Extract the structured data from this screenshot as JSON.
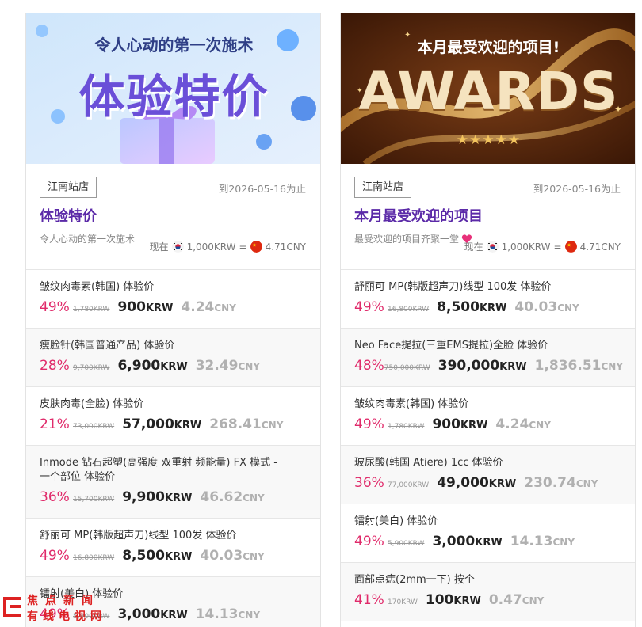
{
  "cards": [
    {
      "banner": {
        "headline": "令人心动的第一次施术",
        "big_text": "体验特价"
      },
      "store": "江南站店",
      "deadline": "到2026-05-16为止",
      "title": "体验特价",
      "subtitle": "令人心动的第一次施术",
      "rate": {
        "prefix": "现在",
        "krw": "1,000KRW",
        "eq": "=",
        "cny": "4.71CNY"
      },
      "items": [
        {
          "name": "皱纹肉毒素(韩国) 体验价",
          "discount": "49%",
          "original": "1,780KRW",
          "price": "900",
          "price_unit": "KRW",
          "cny": "4.24",
          "cny_unit": "CNY"
        },
        {
          "name": "瘦脸针(韩国普通产品) 体验价",
          "discount": "28%",
          "original": "9,700KRW",
          "price": "6,900",
          "price_unit": "KRW",
          "cny": "32.49",
          "cny_unit": "CNY"
        },
        {
          "name": "皮肤肉毒(全脸) 体验价",
          "discount": "21%",
          "original": "73,000KRW",
          "price": "57,000",
          "price_unit": "KRW",
          "cny": "268.41",
          "cny_unit": "CNY"
        },
        {
          "name": "Inmode 钻石超塑(高强度 双重射 频能量) FX 模式 - 一个部位 体验价",
          "discount": "36%",
          "original": "15,700KRW",
          "price": "9,900",
          "price_unit": "KRW",
          "cny": "46.62",
          "cny_unit": "CNY"
        },
        {
          "name": "舒丽可 MP(韩版超声刀)线型 100发 体验价",
          "discount": "49%",
          "original": "16,800KRW",
          "price": "8,500",
          "price_unit": "KRW",
          "cny": "40.03",
          "cny_unit": "CNY"
        },
        {
          "name": "镭射(美白) 体验价",
          "discount": "49%",
          "original": "5,900KRW",
          "price": "3,000",
          "price_unit": "KRW",
          "cny": "14.13",
          "cny_unit": "CNY"
        }
      ]
    },
    {
      "banner": {
        "headline": "本月最受欢迎的项目!",
        "big_text": "AWARDS",
        "stars": "★★★★★"
      },
      "store": "江南站店",
      "deadline": "到2026-05-16为止",
      "title": "本月最受欢迎的项目",
      "subtitle": "最受欢迎的项目齐聚一堂",
      "rate": {
        "prefix": "现在",
        "krw": "1,000KRW",
        "eq": "=",
        "cny": "4.71CNY"
      },
      "items": [
        {
          "name": "舒丽可 MP(韩版超声刀)线型 100发 体验价",
          "discount": "49%",
          "original": "16,800KRW",
          "price": "8,500",
          "price_unit": "KRW",
          "cny": "40.03",
          "cny_unit": "CNY"
        },
        {
          "name": "Neo Face提拉(三重EMS提拉)全脸 体验价",
          "discount": "48%",
          "original": "750,000KRW",
          "price": "390,000",
          "price_unit": "KRW",
          "cny": "1,836.51",
          "cny_unit": "CNY"
        },
        {
          "name": "皱纹肉毒素(韩国) 体验价",
          "discount": "49%",
          "original": "1,780KRW",
          "price": "900",
          "price_unit": "KRW",
          "cny": "4.24",
          "cny_unit": "CNY"
        },
        {
          "name": "玻尿酸(韩国 Atiere) 1cc 体验价",
          "discount": "36%",
          "original": "77,000KRW",
          "price": "49,000",
          "price_unit": "KRW",
          "cny": "230.74",
          "cny_unit": "CNY"
        },
        {
          "name": "镭射(美白) 体验价",
          "discount": "49%",
          "original": "5,900KRW",
          "price": "3,000",
          "price_unit": "KRW",
          "cny": "14.13",
          "cny_unit": "CNY"
        },
        {
          "name": "面部点痣(2mm一下) 按个",
          "discount": "41%",
          "original": "170KRW",
          "price": "100",
          "price_unit": "KRW",
          "cny": "0.47",
          "cny_unit": "CNY"
        }
      ]
    }
  ],
  "watermark": {
    "line1": "焦点新闻",
    "line2": "有线电视网"
  },
  "colors": {
    "accent_purple": "#5b2aa8",
    "discount_pink": "#e02a6a",
    "cny_gray": "#b0b0b0"
  }
}
